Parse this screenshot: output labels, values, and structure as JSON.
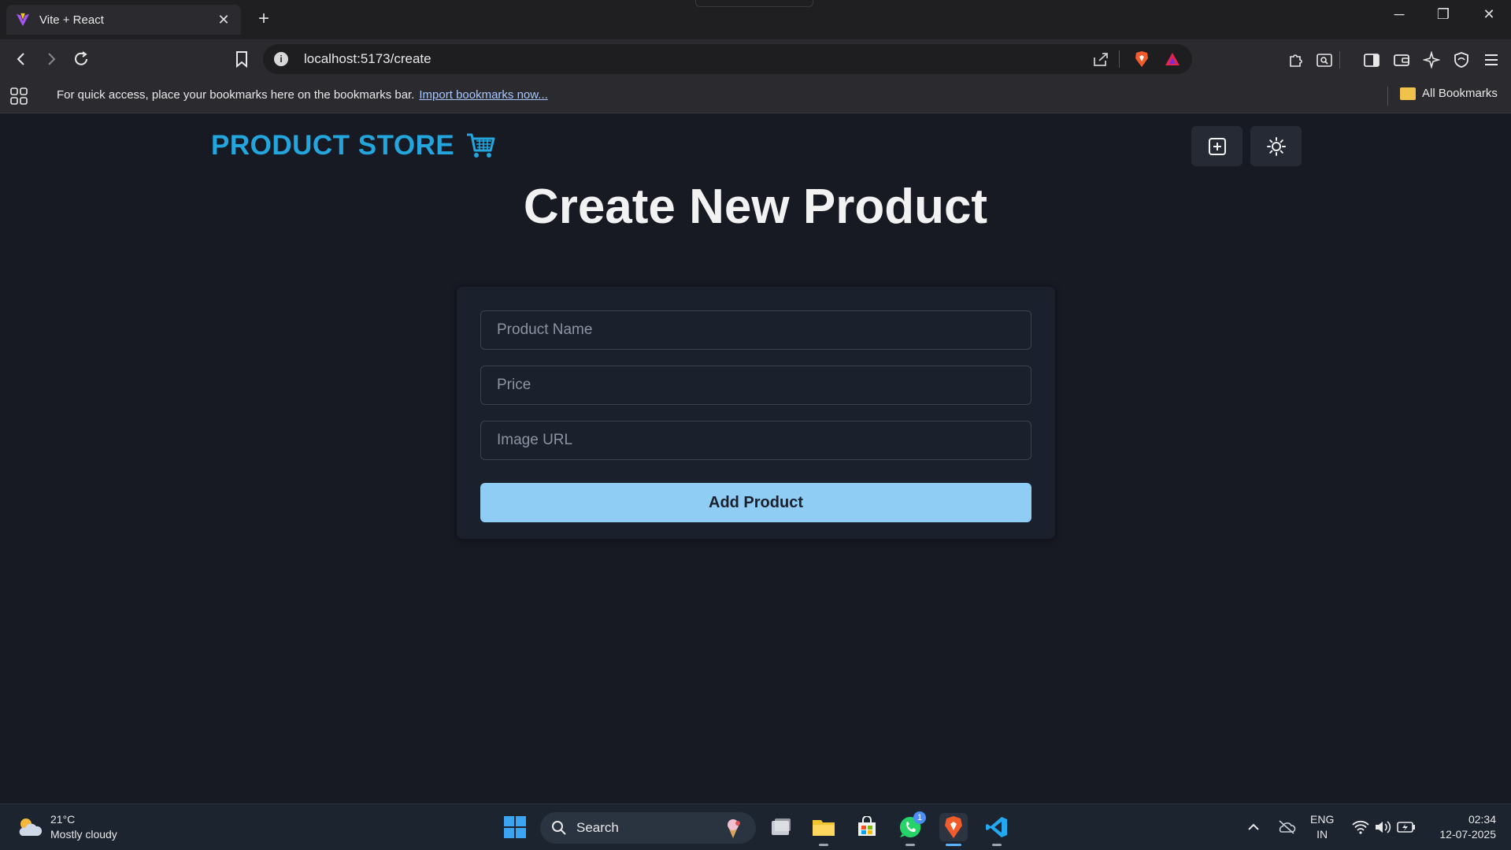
{
  "browser": {
    "tab_title": "Vite + React",
    "url": "localhost:5173/create",
    "bookmarks_prompt": "For quick access, place your bookmarks here on the bookmarks bar.",
    "import_link": "Import bookmarks now...",
    "all_bookmarks": "All Bookmarks"
  },
  "app": {
    "brand": "PRODUCT STORE",
    "brand_color": "#22a6dd",
    "page_title": "Create New Product",
    "form": {
      "name_placeholder": "Product Name",
      "price_placeholder": "Price",
      "image_placeholder": "Image URL",
      "submit_label": "Add Product",
      "submit_color": "#90cdf4"
    }
  },
  "taskbar": {
    "temperature": "21°C",
    "weather": "Mostly cloudy",
    "search_label": "Search",
    "whatsapp_badge": "1",
    "lang_primary": "ENG",
    "lang_region": "IN",
    "time": "02:34",
    "date": "12-07-2025"
  }
}
